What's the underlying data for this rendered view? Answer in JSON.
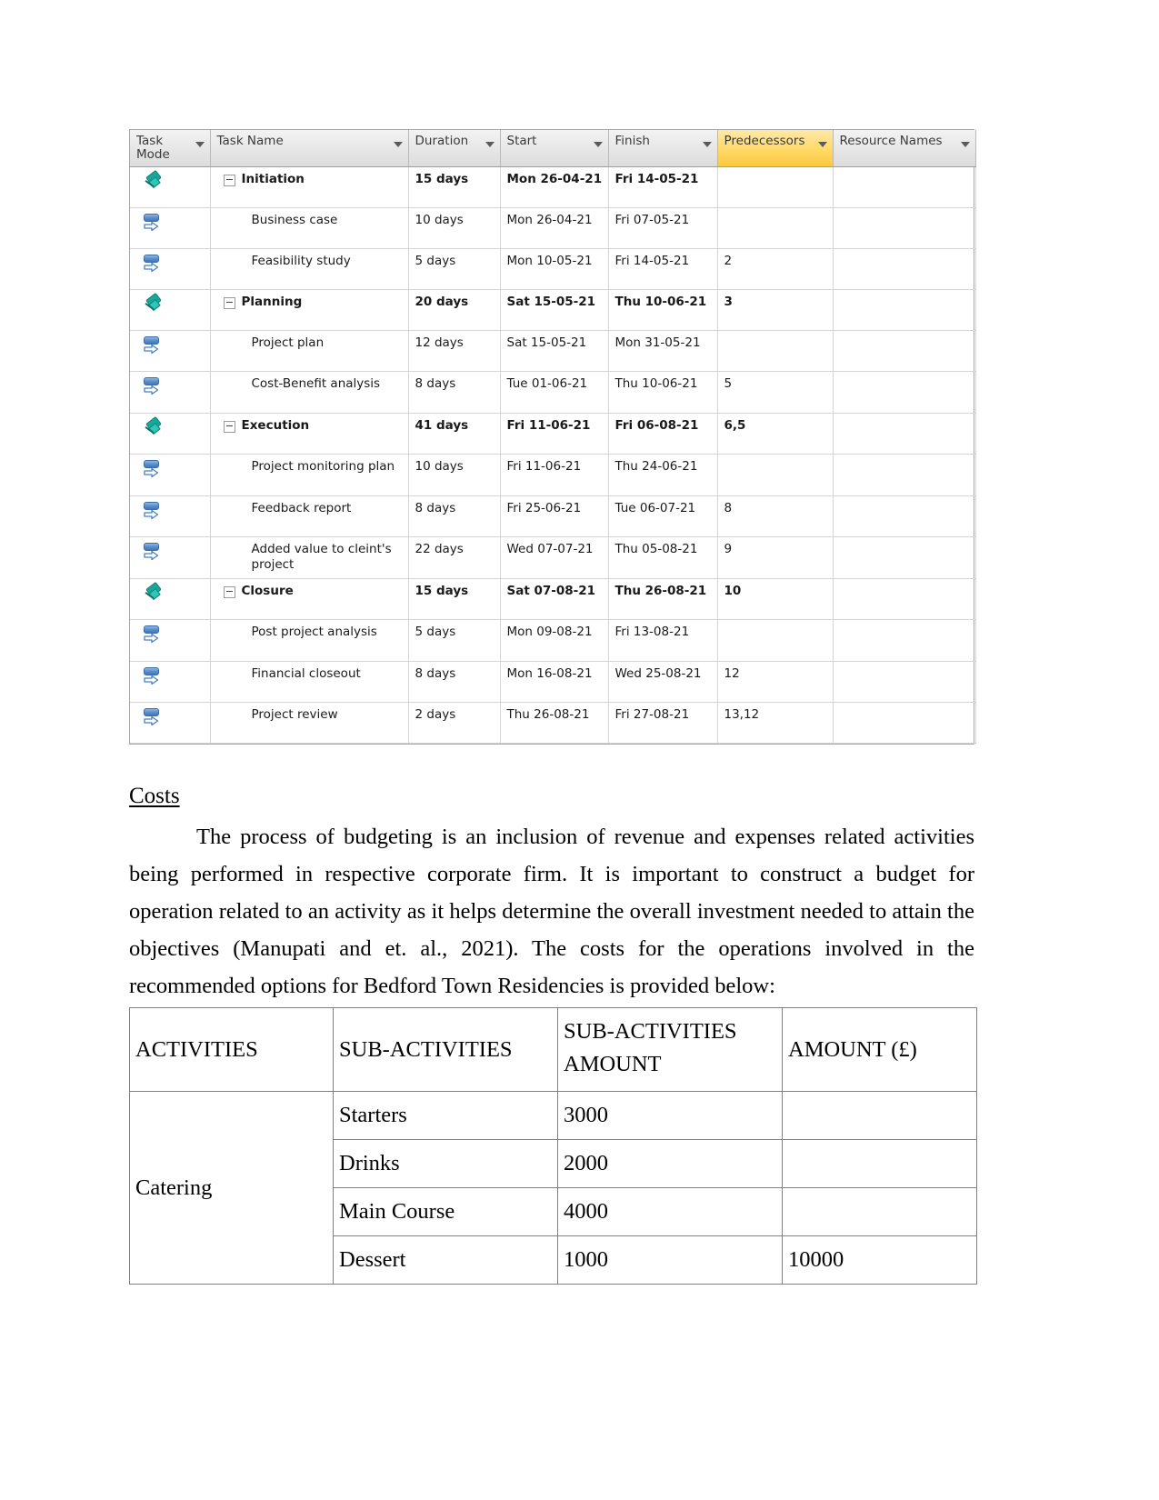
{
  "gantt": {
    "columns": [
      {
        "label": "Task\nMode",
        "key": "task_mode",
        "filter": true,
        "highlighted": false
      },
      {
        "label": "Task Name",
        "key": "task_name",
        "filter": true,
        "highlighted": false
      },
      {
        "label": "Duration",
        "key": "duration",
        "filter": true,
        "highlighted": false
      },
      {
        "label": "Start",
        "key": "start",
        "filter": true,
        "highlighted": false
      },
      {
        "label": "Finish",
        "key": "finish",
        "filter": true,
        "highlighted": false
      },
      {
        "label": "Predecessors",
        "key": "predecessors",
        "filter": true,
        "highlighted": true
      },
      {
        "label": "Resource Names",
        "key": "resource_names",
        "filter": true,
        "highlighted": false
      }
    ],
    "header": {
      "task_mode": "Task Mode",
      "task_mode_line1": "Task",
      "task_mode_line2": "Mode",
      "task_name": "Task Name",
      "duration": "Duration",
      "start": "Start",
      "finish": "Finish",
      "predecessors": "Predecessors",
      "resource_names": "Resource Names"
    },
    "rows": [
      {
        "mode_icon": "pin-icon",
        "summary": true,
        "name": "Initiation",
        "duration": "15 days",
        "start": "Mon 26-04-21",
        "finish": "Fri 14-05-21",
        "predecessors": "",
        "resources": ""
      },
      {
        "mode_icon": "manual-schedule-icon",
        "summary": false,
        "name": "Business case",
        "duration": "10 days",
        "start": "Mon 26-04-21",
        "finish": "Fri 07-05-21",
        "predecessors": "",
        "resources": ""
      },
      {
        "mode_icon": "manual-schedule-icon",
        "summary": false,
        "name": "Feasibility study",
        "duration": "5 days",
        "start": "Mon 10-05-21",
        "finish": "Fri 14-05-21",
        "predecessors": "2",
        "resources": ""
      },
      {
        "mode_icon": "pin-icon",
        "summary": true,
        "name": "Planning",
        "duration": "20 days",
        "start": "Sat 15-05-21",
        "finish": "Thu 10-06-21",
        "predecessors": "3",
        "resources": ""
      },
      {
        "mode_icon": "manual-schedule-icon",
        "summary": false,
        "name": "Project plan",
        "duration": "12 days",
        "start": "Sat 15-05-21",
        "finish": "Mon 31-05-21",
        "predecessors": "",
        "resources": ""
      },
      {
        "mode_icon": "manual-schedule-icon",
        "summary": false,
        "name": "Cost-Benefit analysis",
        "duration": "8 days",
        "start": "Tue 01-06-21",
        "finish": "Thu 10-06-21",
        "predecessors": "5",
        "resources": ""
      },
      {
        "mode_icon": "pin-icon",
        "summary": true,
        "name": "Execution",
        "duration": "41 days",
        "start": "Fri 11-06-21",
        "finish": "Fri 06-08-21",
        "predecessors": "6,5",
        "resources": ""
      },
      {
        "mode_icon": "manual-schedule-icon",
        "summary": false,
        "name": "Project monitoring plan",
        "duration": "10 days",
        "start": "Fri 11-06-21",
        "finish": "Thu 24-06-21",
        "predecessors": "",
        "resources": ""
      },
      {
        "mode_icon": "manual-schedule-icon",
        "summary": false,
        "name": "Feedback report",
        "duration": "8 days",
        "start": "Fri 25-06-21",
        "finish": "Tue 06-07-21",
        "predecessors": "8",
        "resources": ""
      },
      {
        "mode_icon": "manual-schedule-icon",
        "summary": false,
        "name": "Added value to cleint's project",
        "duration": "22 days",
        "start": "Wed 07-07-21",
        "finish": "Thu 05-08-21",
        "predecessors": "9",
        "resources": ""
      },
      {
        "mode_icon": "pin-icon",
        "summary": true,
        "name": "Closure",
        "duration": "15 days",
        "start": "Sat 07-08-21",
        "finish": "Thu 26-08-21",
        "predecessors": "10",
        "resources": ""
      },
      {
        "mode_icon": "manual-schedule-icon",
        "summary": false,
        "name": "Post project analysis",
        "duration": "5 days",
        "start": "Mon 09-08-21",
        "finish": "Fri 13-08-21",
        "predecessors": "",
        "resources": ""
      },
      {
        "mode_icon": "manual-schedule-icon",
        "summary": false,
        "name": "Financial closeout",
        "duration": "8 days",
        "start": "Mon 16-08-21",
        "finish": "Wed 25-08-21",
        "predecessors": "12",
        "resources": ""
      },
      {
        "mode_icon": "manual-schedule-icon",
        "summary": false,
        "name": "Project review",
        "duration": "2 days",
        "start": "Thu 26-08-21",
        "finish": "Fri 27-08-21",
        "predecessors": "13,12",
        "resources": ""
      }
    ]
  },
  "document": {
    "heading": "Costs",
    "paragraph": "The process of budgeting is an inclusion of revenue and expenses related activities being performed in respective corporate firm. It is important to construct a budget for operation related to an activity as it helps determine the overall investment needed to attain the objectives (Manupati and et. al., 2021). The costs for the operations involved in the recommended options for Bedford Town Residencies is provided below:"
  },
  "costs_table": {
    "headers": {
      "activities": "ACTIVITIES",
      "sub_activities": "SUB-ACTIVITIES",
      "sub_activities_amount_line1": "SUB-ACTIVITIES",
      "sub_activities_amount_line2": "AMOUNT",
      "amount": "AMOUNT (£)"
    },
    "group": {
      "activity": "Catering",
      "rows": [
        {
          "sub_activity": "Starters",
          "sub_amount": "3000",
          "amount": ""
        },
        {
          "sub_activity": "Drinks",
          "sub_amount": "2000",
          "amount": ""
        },
        {
          "sub_activity": "Main Course",
          "sub_amount": "4000",
          "amount": ""
        },
        {
          "sub_activity": "Dessert",
          "sub_amount": "1000",
          "amount": "10000"
        }
      ]
    }
  },
  "colors": {
    "highlight_header": "#ffd966",
    "grid_line": "#d4d4d4",
    "header_text": "#3a3a3a",
    "table_border": "#808080"
  }
}
